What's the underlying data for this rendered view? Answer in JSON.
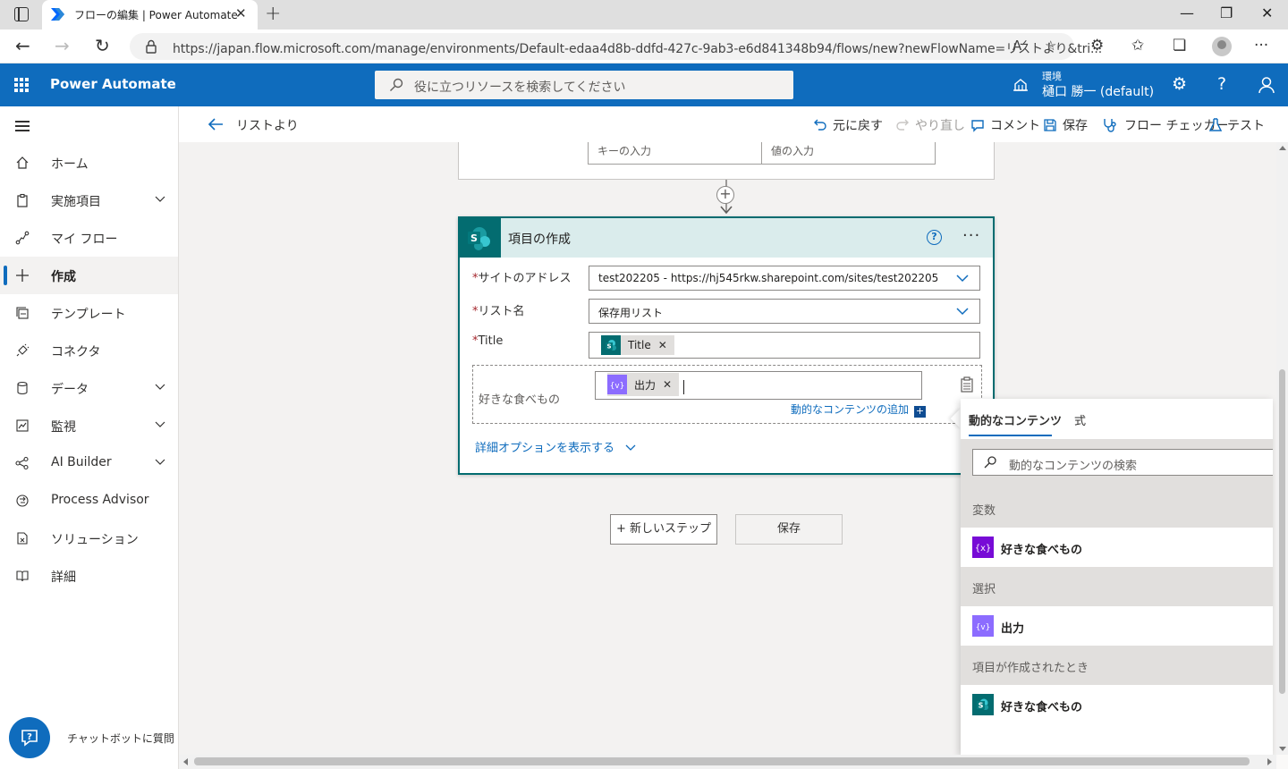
{
  "browser": {
    "tab_title": "フローの編集 | Power Automate",
    "url": "https://japan.flow.microsoft.com/manage/environments/Default-edaa4d8b-ddfd-427c-9ab3-e6d841348b94/flows/new?newFlowName=リストより&tri..."
  },
  "header": {
    "app_name": "Power Automate",
    "search_placeholder": "役に立つリソースを検索してください",
    "env_label": "環境",
    "env_name": "樋口 勝一 (default)"
  },
  "sidebar": {
    "items": [
      {
        "label": "ホーム",
        "icon": "home-icon",
        "chevron": false
      },
      {
        "label": "実施項目",
        "icon": "clipboard-icon",
        "chevron": true
      },
      {
        "label": "マイ フロー",
        "icon": "flow-icon",
        "chevron": false
      },
      {
        "label": "作成",
        "icon": "plus-icon",
        "chevron": false,
        "active": true
      },
      {
        "label": "テンプレート",
        "icon": "template-icon",
        "chevron": false
      },
      {
        "label": "コネクタ",
        "icon": "connector-icon",
        "chevron": false
      },
      {
        "label": "データ",
        "icon": "database-icon",
        "chevron": true
      },
      {
        "label": "監視",
        "icon": "monitor-icon",
        "chevron": true
      },
      {
        "label": "AI Builder",
        "icon": "ai-builder-icon",
        "chevron": true
      },
      {
        "label": "Process Advisor",
        "icon": "process-advisor-icon",
        "chevron": false
      },
      {
        "label": "ソリューション",
        "icon": "solution-icon",
        "chevron": false
      },
      {
        "label": "詳細",
        "icon": "book-icon",
        "chevron": false
      }
    ],
    "chatbot_label": "チャットボットに質問"
  },
  "commandbar": {
    "flow_name": "リストより",
    "undo": "元に戻す",
    "redo": "やり直し",
    "comment": "コメント",
    "save": "保存",
    "flow_checker": "フロー チェッカー",
    "test": "テスト"
  },
  "canvas": {
    "prev_card": {
      "key_placeholder": "キーの入力",
      "value_placeholder": "値の入力"
    },
    "card": {
      "title": "項目の作成",
      "fields": {
        "site_label": "サイトのアドレス",
        "site_value": "test202205 - https://hj545rkw.sharepoint.com/sites/test202205",
        "list_label": "リスト名",
        "list_value": "保存用リスト",
        "title_label": "Title",
        "title_token": "Title",
        "fav_label": "好きな食べもの",
        "fav_token": "出力",
        "required_mark": "*"
      },
      "add_dynamic": "動的なコンテンツの追加",
      "show_advanced": "詳細オプションを表示する"
    },
    "new_step": "+ 新しいステップ",
    "save_button": "保存"
  },
  "dynamic_panel": {
    "tab_dynamic": "動的なコンテンツ",
    "tab_expression": "式",
    "search_placeholder": "動的なコンテンツの検索",
    "groups": [
      {
        "name": "変数",
        "item": "好きな食べもの",
        "icon": "variable-icon"
      },
      {
        "name": "選択",
        "item": "出力",
        "icon": "data-operation-icon"
      },
      {
        "name": "項目が作成されたとき",
        "item": "好きな食べもの",
        "icon": "sharepoint-icon"
      }
    ]
  },
  "colors": {
    "brand": "#0f6cbd",
    "sharepoint": "#036c70",
    "variable": "#770bd6",
    "data_operation": "#8c6cff"
  }
}
